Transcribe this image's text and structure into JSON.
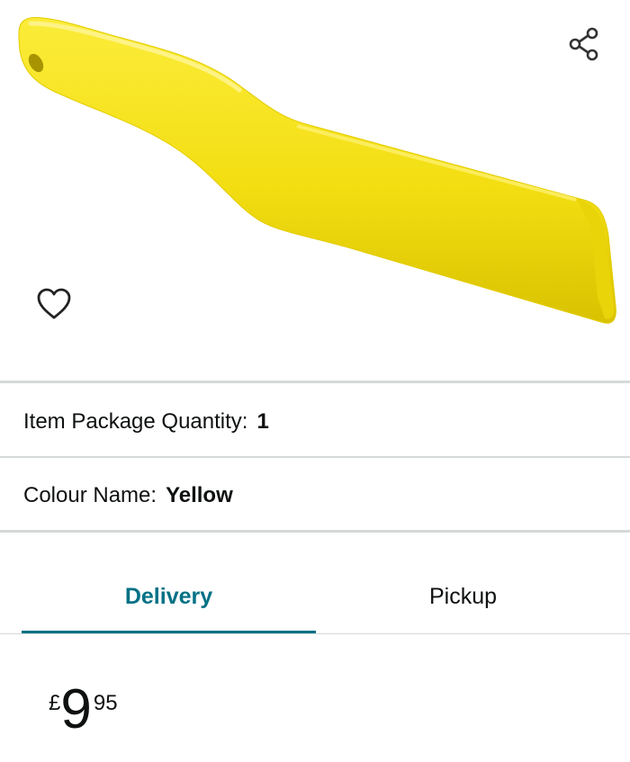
{
  "product": {
    "image_icon": "yellow-plastic-tool-image",
    "image_color": "#f5e21a",
    "share_icon": "share-icon",
    "wishlist_icon": "heart-icon"
  },
  "variations": [
    {
      "label": "Item Package Quantity:",
      "value": "1"
    },
    {
      "label": "Colour Name:",
      "value": "Yellow"
    }
  ],
  "tabs": {
    "delivery_label": "Delivery",
    "pickup_label": "Pickup",
    "active": "Delivery",
    "accent_color": "#007185"
  },
  "price": {
    "currency": "£",
    "whole": "9",
    "fraction": "95"
  }
}
